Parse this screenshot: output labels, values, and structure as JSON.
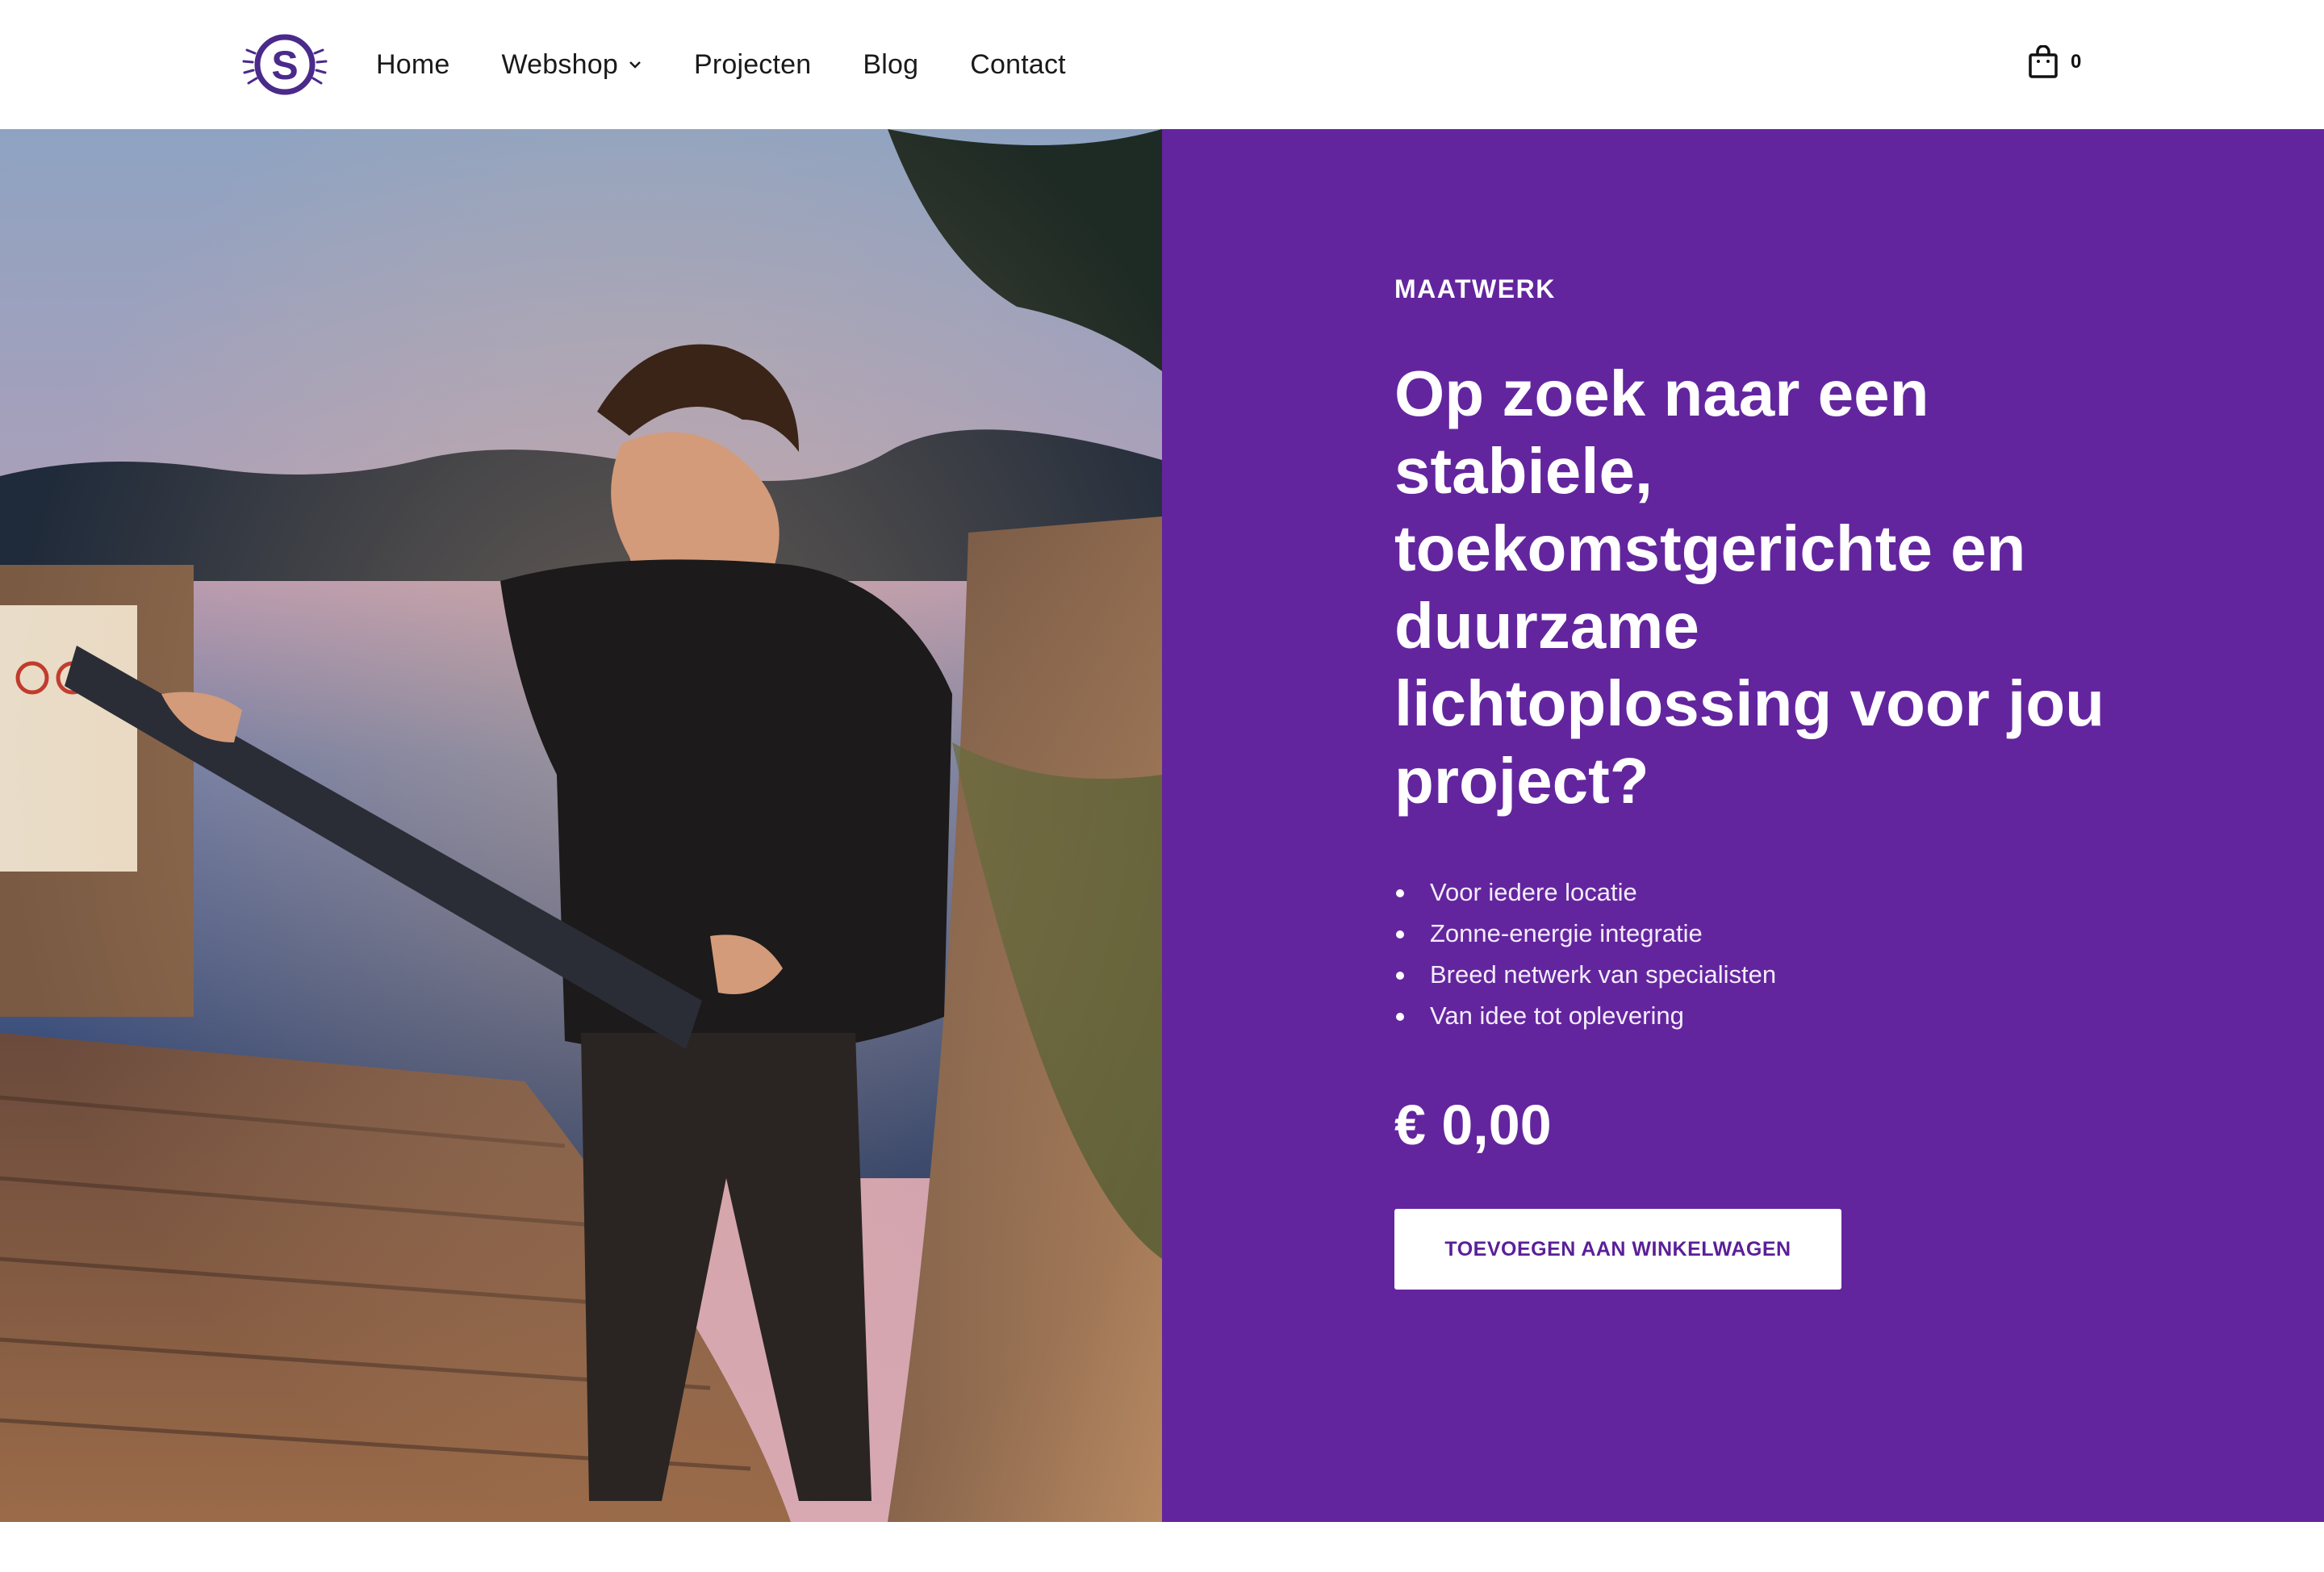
{
  "colors": {
    "accent": "#63259e",
    "button_text": "#5b1f98",
    "background": "#ffffff"
  },
  "header": {
    "logo_icon": "sun-s-logo-icon",
    "nav": [
      {
        "label": "Home"
      },
      {
        "label": "Webshop",
        "has_dropdown": true
      },
      {
        "label": "Projecten"
      },
      {
        "label": "Blog"
      },
      {
        "label": "Contact"
      }
    ],
    "cart": {
      "icon": "shopping-bag-icon",
      "count": "0"
    }
  },
  "hero": {
    "image_subject": "photo-person-holding-solar-panel-at-lake",
    "eyebrow": "MAATWERK",
    "headline": "Op zoek naar een stabiele, toekomstgerichte en duurzame lichtoplossing voor jou project?",
    "features": [
      "Voor iedere locatie",
      "Zonne-energie integratie",
      "Breed netwerk van specialisten",
      "Van idee tot oplevering"
    ],
    "price": "€ 0,00",
    "cta_label": "TOEVOEGEN AAN WINKELWAGEN"
  }
}
